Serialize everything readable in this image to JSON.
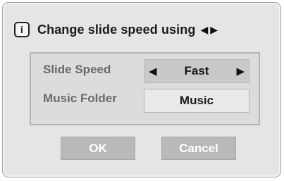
{
  "dialog": {
    "title": "Change slide speed using",
    "title_arrow_left": "◀",
    "title_arrow_right": "▶",
    "info_icon_glyph": "i"
  },
  "settings": {
    "slide_speed": {
      "label": "Slide Speed",
      "value": "Fast",
      "arrow_left": "◀",
      "arrow_right": "▶"
    },
    "music_folder": {
      "label": "Music Folder",
      "value": "Music"
    }
  },
  "buttons": {
    "ok": "OK",
    "cancel": "Cancel"
  },
  "colors": {
    "dialog_bg": "#e5e5e5",
    "label_text": "#6a6a6a",
    "button_bg": "#b9b9b9",
    "button_text": "#ffffff"
  }
}
